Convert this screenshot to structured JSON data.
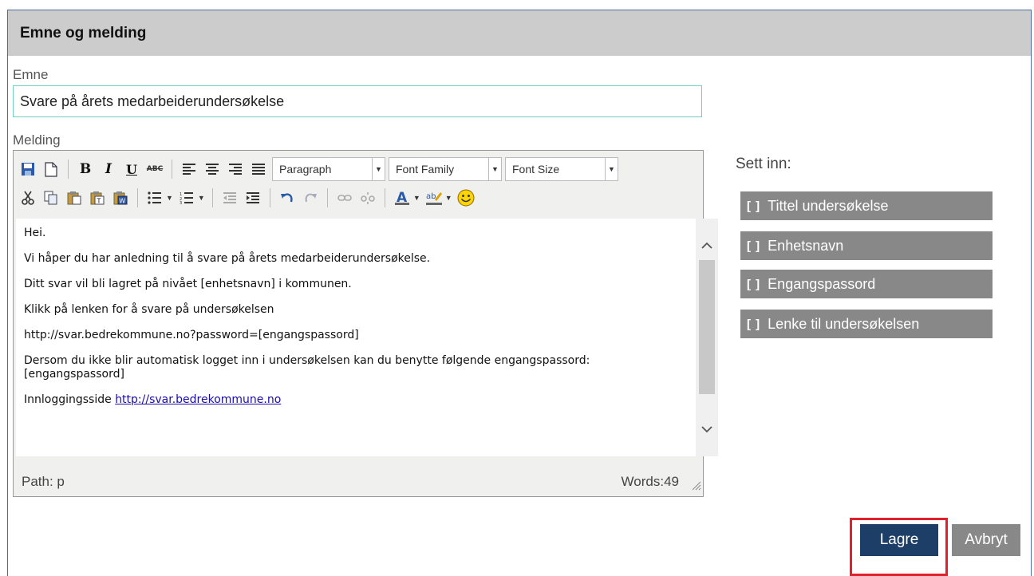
{
  "dialog": {
    "title": "Emne og melding"
  },
  "subject": {
    "label": "Emne",
    "value": "Svare på årets medarbeiderundersøkelse"
  },
  "message": {
    "label": "Melding",
    "toolbar": {
      "bold": "B",
      "italic": "I",
      "underline": "U",
      "strike": "ABC",
      "format_select": "Paragraph",
      "font_family_select": "Font Family",
      "font_size_select": "Font Size",
      "font_color_letter": "A",
      "highlight_letters": "ab"
    },
    "content": {
      "greeting": "Hei.",
      "line1": "Vi håper du har anledning til å svare på årets medarbeiderundersøkelse.",
      "line2": "Ditt svar vil bli lagret på nivået [enhetsnavn] i kommunen.",
      "line3": "Klikk på lenken for å svare på undersøkelsen",
      "line4": "http://svar.bedrekommune.no?password=[engangspassord]",
      "line5": "Dersom du ikke blir automatisk logget inn i undersøkelsen kan du benytte følgende engangspassord: [engangspassord]",
      "login_prefix": "Innloggingsside ",
      "login_link": "http://svar.bedrekommune.no"
    },
    "status": {
      "path": "Path: p",
      "words": "Words:49"
    }
  },
  "insert": {
    "label": "Sett inn:",
    "bracket": "[ ]",
    "items": [
      {
        "label": "Tittel undersøkelse"
      },
      {
        "label": "Enhetsnavn"
      },
      {
        "label": "Engangspassord"
      },
      {
        "label": "Lenke til undersøkelsen"
      }
    ]
  },
  "actions": {
    "save": "Lagre",
    "cancel": "Avbryt"
  },
  "colors": {
    "primary": "#1d3e66",
    "secondary": "#888888",
    "highlight": "#e0202a",
    "input_border": "#6fcfc6"
  }
}
